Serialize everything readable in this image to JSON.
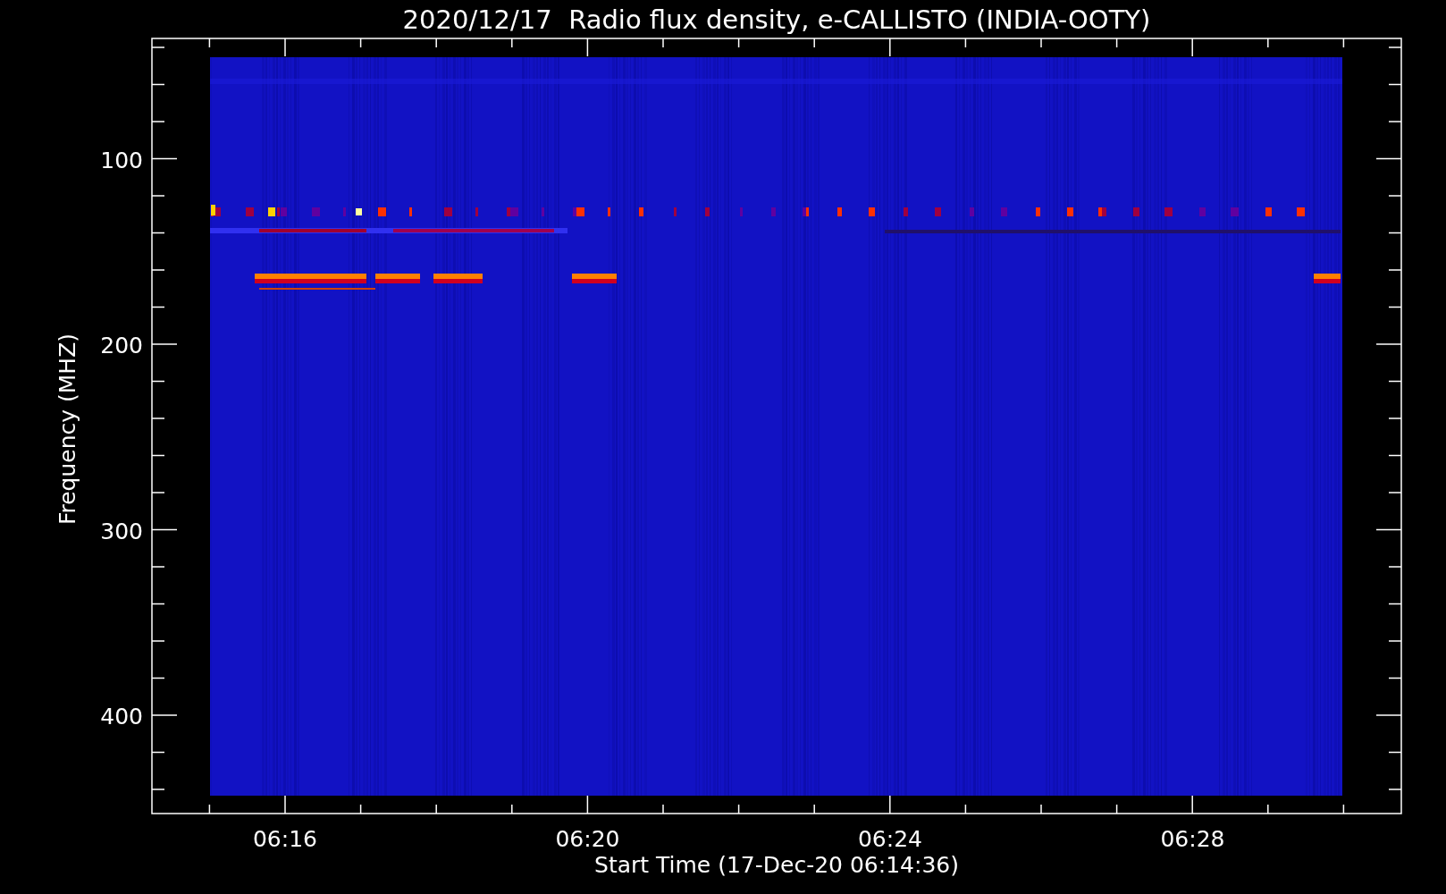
{
  "chart": {
    "title": "2020/12/17  Radio flux density, e-CALLISTO (INDIA-OOTY)",
    "xlabel": "Start Time (17-Dec-20 06:14:36)",
    "ylabel": "Frequency (MHZ)",
    "xticks": [
      "06:16",
      "06:20",
      "06:24",
      "06:28"
    ],
    "yticks": [
      "100",
      "200",
      "300",
      "400"
    ]
  }
}
